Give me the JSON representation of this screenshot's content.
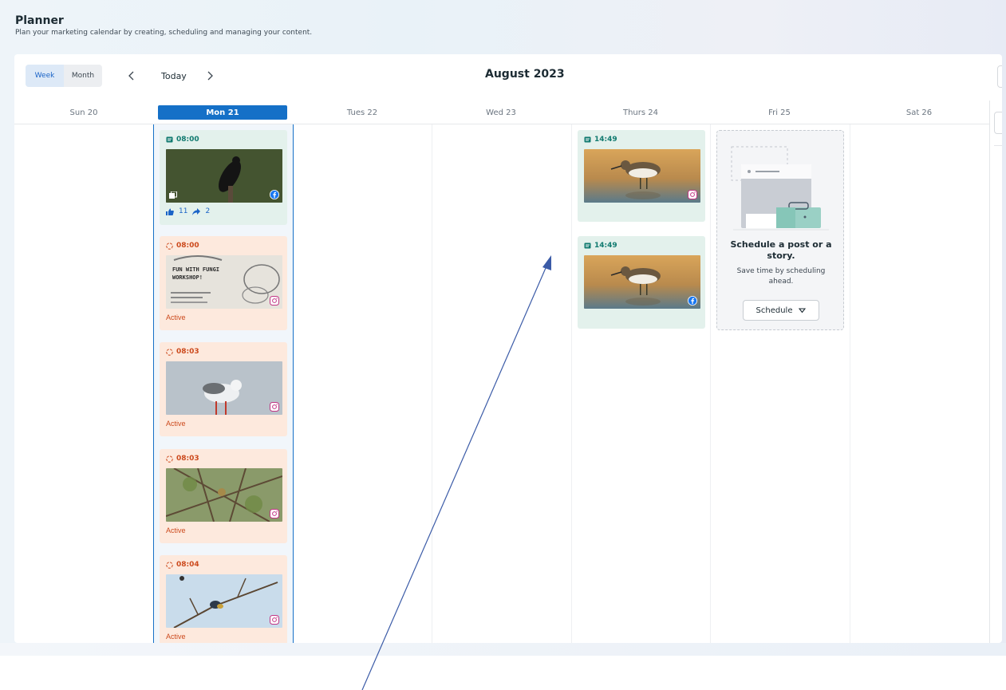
{
  "header": {
    "title": "Planner",
    "subtitle": "Plan your marketing calendar by creating, scheduling and managing your content."
  },
  "toolbar": {
    "week_label": "Week",
    "month_label": "Month",
    "today_label": "Today",
    "period_title": "August 2023"
  },
  "days": [
    "Sun 20",
    "Mon 21",
    "Tues 22",
    "Wed 23",
    "Thurs 24",
    "Fri 25",
    "Sat 26"
  ],
  "posts": {
    "mon": [
      {
        "time": "08:00",
        "type": "published",
        "platform": "facebook-icon",
        "likes": "11",
        "shares": "2"
      },
      {
        "time": "08:00",
        "type": "scheduled",
        "platform": "instagram-icon",
        "status": "Active",
        "poster_lines": [
          "FUN WITH FUNGI",
          "WORKSHOP!"
        ]
      },
      {
        "time": "08:03",
        "type": "scheduled",
        "platform": "instagram-icon",
        "status": "Active"
      },
      {
        "time": "08:03",
        "type": "scheduled",
        "platform": "instagram-icon",
        "status": "Active"
      },
      {
        "time": "08:04",
        "type": "scheduled",
        "platform": "instagram-icon",
        "status": "Active"
      }
    ],
    "thu": [
      {
        "time": "14:49",
        "type": "published",
        "platform": "instagram-icon"
      },
      {
        "time": "14:49",
        "type": "published",
        "platform": "facebook-icon"
      }
    ]
  },
  "empty_state": {
    "title": "Schedule a post or a story.",
    "text": "Save time by scheduling ahead.",
    "button_label": "Schedule"
  },
  "colors": {
    "accent": "#1570c7",
    "published_bg": "#e3f1ec",
    "scheduled_bg": "#fde9dd",
    "published_text": "#107a6f",
    "scheduled_text": "#cc4a1d",
    "annotation_arrow": "#3b5ba7"
  }
}
